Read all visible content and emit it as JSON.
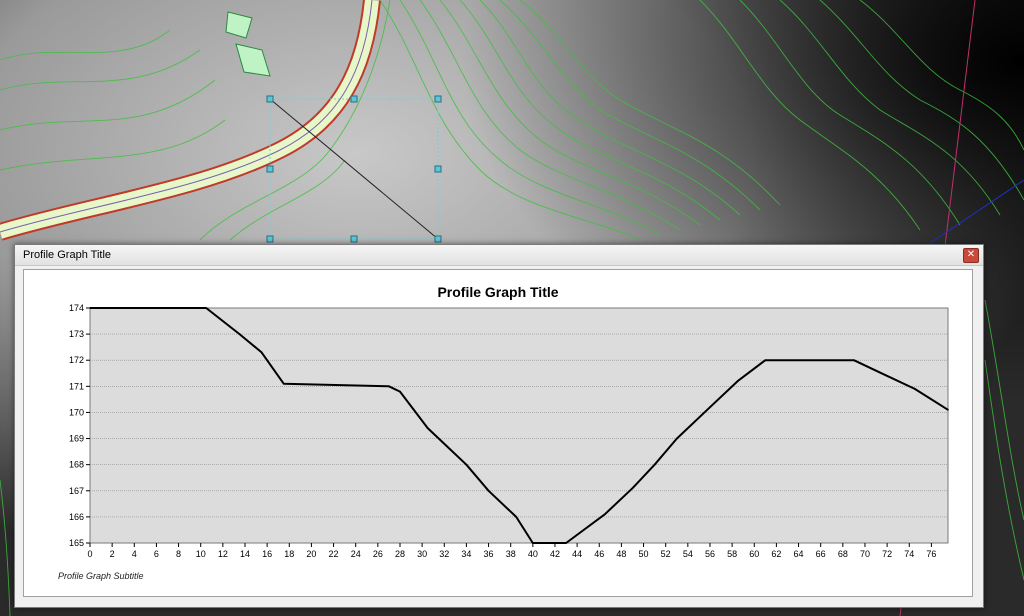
{
  "window": {
    "title": "Profile Graph Title"
  },
  "colors": {
    "plot_background": "#dcdcdc",
    "gridline": "#8c8c8c",
    "profile_line": "#000000",
    "contour_line": "#3fbf3f",
    "road_fill": "#e8f7c8",
    "parcel_fill": "#bff3c6"
  },
  "icons": {
    "close": "close-icon"
  },
  "chart_data": {
    "type": "line",
    "title": "Profile Graph Title",
    "subtitle": "Profile Graph Subtitle",
    "xlabel": "",
    "ylabel": "",
    "xlim": [
      0,
      77.5
    ],
    "ylim": [
      165,
      174
    ],
    "grid": "horizontal",
    "xticks": [
      0,
      2,
      4,
      6,
      8,
      10,
      12,
      14,
      16,
      18,
      20,
      22,
      24,
      26,
      28,
      30,
      32,
      34,
      36,
      38,
      40,
      42,
      44,
      46,
      48,
      50,
      52,
      54,
      56,
      58,
      60,
      62,
      64,
      66,
      68,
      70,
      72,
      74,
      76
    ],
    "yticks": [
      165,
      166,
      167,
      168,
      169,
      170,
      171,
      172,
      173,
      174
    ],
    "series": [
      {
        "x": [
          0,
          10.5,
          13.5,
          15.5,
          17.5,
          27,
          28,
          30.5,
          32.5,
          34,
          36,
          38.5,
          40,
          43,
          46.5,
          49,
          51,
          53,
          56,
          58.5,
          61,
          69,
          71.5,
          74.5,
          77.5
        ],
        "y": [
          174,
          174,
          173,
          172.3,
          171.1,
          171,
          170.8,
          169.4,
          168.6,
          168,
          167,
          166,
          165,
          165,
          166.1,
          167.1,
          168,
          169,
          170.2,
          171.2,
          172,
          172,
          171.5,
          170.9,
          170.1
        ]
      }
    ]
  }
}
